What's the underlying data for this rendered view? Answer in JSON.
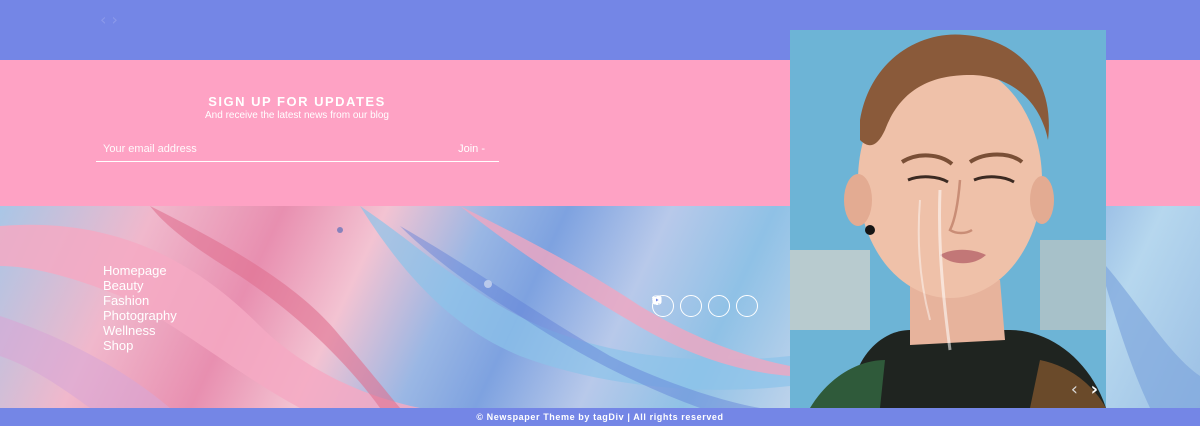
{
  "signup": {
    "title": "SIGN UP FOR UPDATES",
    "subtitle": "And receive the latest news from our blog",
    "email_placeholder": "Your email address",
    "join_label": "Join -"
  },
  "top_nav": {
    "arrows": "‹ ›"
  },
  "footer_menu": {
    "items": [
      "Homepage",
      "Beauty",
      "Fashion",
      "Photography",
      "Wellness",
      "Shop"
    ]
  },
  "social": {
    "icons": [
      "facebook-icon",
      "instagram-icon",
      "twitter-icon",
      "youtube-icon"
    ]
  },
  "slider": {
    "prev": "‹",
    "next": "›"
  },
  "footer": {
    "copyright": "© Newspaper Theme by tagDiv | All rights reserved"
  },
  "colors": {
    "top_band": "#7486e6",
    "signup_bg": "#fea2c4",
    "text": "#ffffff"
  }
}
